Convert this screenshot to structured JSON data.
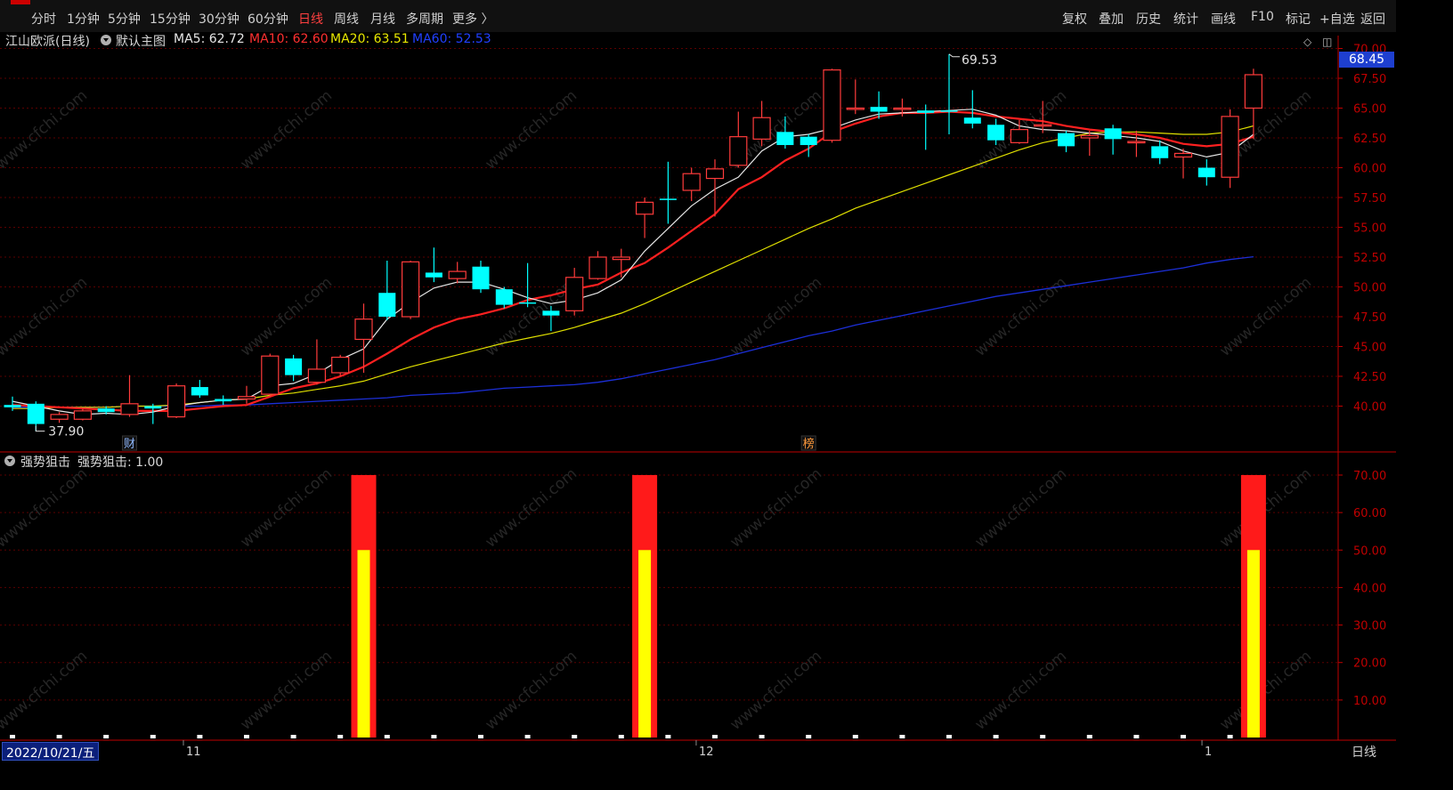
{
  "topbar": {
    "periods": [
      "分时",
      "1分钟",
      "5分钟",
      "15分钟",
      "30分钟",
      "60分钟",
      "日线",
      "周线",
      "月线",
      "多周期",
      "更多 〉"
    ],
    "active_period": "日线",
    "tools": [
      "复权",
      "叠加",
      "历史",
      "统计",
      "画线",
      "F10",
      "标记",
      "+自选",
      "返回"
    ]
  },
  "infobar": {
    "stock": "江山欧派(日线)",
    "template": "默认主图",
    "ma5": "MA5: 62.72",
    "ma10": "MA10: 62.60",
    "ma20": "MA20: 63.51",
    "ma60": "MA60: 52.53"
  },
  "subinfo": {
    "indicator": "强势狙击",
    "value_label": "强势狙击: 1.00"
  },
  "price_badge": "68.45",
  "date_label": "2022/10/21/五",
  "period_label": "日线",
  "watermark": "www.cfchi.com",
  "colors": {
    "up": "#ff3b3b",
    "down": "#00ffff",
    "ma5": "#e6e6e6",
    "ma10": "#ff2020",
    "ma20": "#e0e000",
    "ma60": "#1c2fd8",
    "bar_outer": "#ff1a1a",
    "bar_inner": "#ffff00",
    "axis_red": "#c00000"
  },
  "chart_data": [
    {
      "type": "candlestick",
      "title": "江山欧派(日线)",
      "ylim": [
        37.5,
        70.5
      ],
      "yticks": [
        "70.00",
        "67.50",
        "65.00",
        "62.50",
        "60.00",
        "57.50",
        "55.00",
        "52.50",
        "50.00",
        "47.50",
        "45.00",
        "42.50",
        "40.00"
      ],
      "xtick_labels": [
        "11",
        "12",
        "1"
      ],
      "candles": [
        {
          "o": 40.1,
          "c": 39.9,
          "h": 40.8,
          "l": 39.6
        },
        {
          "o": 40.2,
          "c": 38.5,
          "h": 40.4,
          "l": 37.9
        },
        {
          "o": 38.9,
          "c": 39.3,
          "h": 39.5,
          "l": 38.6
        },
        {
          "o": 38.9,
          "c": 39.6,
          "h": 39.8,
          "l": 38.8
        },
        {
          "o": 39.8,
          "c": 39.5,
          "h": 40.0,
          "l": 39.3
        },
        {
          "o": 39.3,
          "c": 40.2,
          "h": 42.6,
          "l": 39.1
        },
        {
          "o": 40.0,
          "c": 39.8,
          "h": 40.2,
          "l": 38.5
        },
        {
          "o": 39.1,
          "c": 41.7,
          "h": 41.9,
          "l": 39.0
        },
        {
          "o": 41.6,
          "c": 40.9,
          "h": 42.2,
          "l": 40.7
        },
        {
          "o": 40.6,
          "c": 40.4,
          "h": 40.9,
          "l": 40.1
        },
        {
          "o": 40.6,
          "c": 40.8,
          "h": 41.7,
          "l": 40.2
        },
        {
          "o": 41.0,
          "c": 44.2,
          "h": 44.4,
          "l": 40.8
        },
        {
          "o": 44.0,
          "c": 42.6,
          "h": 44.3,
          "l": 42.1
        },
        {
          "o": 42.0,
          "c": 43.1,
          "h": 45.6,
          "l": 41.8
        },
        {
          "o": 42.8,
          "c": 44.1,
          "h": 44.3,
          "l": 42.5
        },
        {
          "o": 45.6,
          "c": 47.3,
          "h": 48.6,
          "l": 42.8
        },
        {
          "o": 49.5,
          "c": 47.5,
          "h": 52.2,
          "l": 47.2
        },
        {
          "o": 47.5,
          "c": 52.1,
          "h": 52.2,
          "l": 47.3
        },
        {
          "o": 51.2,
          "c": 50.8,
          "h": 53.3,
          "l": 50.4
        },
        {
          "o": 50.7,
          "c": 51.3,
          "h": 52.1,
          "l": 50.3
        },
        {
          "o": 51.7,
          "c": 49.8,
          "h": 52.2,
          "l": 49.5
        },
        {
          "o": 49.8,
          "c": 48.5,
          "h": 50.0,
          "l": 48.2
        },
        {
          "o": 48.7,
          "c": 48.6,
          "h": 52.0,
          "l": 48.3
        },
        {
          "o": 48.0,
          "c": 47.6,
          "h": 48.4,
          "l": 46.3
        },
        {
          "o": 48.0,
          "c": 50.8,
          "h": 51.6,
          "l": 47.6
        },
        {
          "o": 50.7,
          "c": 52.5,
          "h": 53.0,
          "l": 50.6
        },
        {
          "o": 52.3,
          "c": 52.5,
          "h": 53.2,
          "l": 50.8
        },
        {
          "o": 56.1,
          "c": 57.1,
          "h": 57.5,
          "l": 54.1
        },
        {
          "o": 57.4,
          "c": 57.3,
          "h": 60.5,
          "l": 55.3
        },
        {
          "o": 58.1,
          "c": 59.5,
          "h": 60.0,
          "l": 57.2
        },
        {
          "o": 59.1,
          "c": 59.9,
          "h": 60.7,
          "l": 55.9
        },
        {
          "o": 60.2,
          "c": 62.6,
          "h": 64.7,
          "l": 60.0
        },
        {
          "o": 62.4,
          "c": 64.2,
          "h": 65.6,
          "l": 61.8
        },
        {
          "o": 63.0,
          "c": 61.9,
          "h": 64.3,
          "l": 61.6
        },
        {
          "o": 62.6,
          "c": 61.9,
          "h": 62.8,
          "l": 60.9
        },
        {
          "o": 62.3,
          "c": 68.2,
          "h": 68.3,
          "l": 62.1
        },
        {
          "o": 65.0,
          "c": 65.0,
          "h": 67.4,
          "l": 64.5
        },
        {
          "o": 65.1,
          "c": 64.7,
          "h": 66.4,
          "l": 64.1
        },
        {
          "o": 64.9,
          "c": 65.0,
          "h": 65.8,
          "l": 64.3
        },
        {
          "o": 64.8,
          "c": 64.6,
          "h": 65.3,
          "l": 61.5
        },
        {
          "o": 64.8,
          "c": 64.7,
          "h": 69.53,
          "l": 62.8
        },
        {
          "o": 64.2,
          "c": 63.7,
          "h": 66.5,
          "l": 63.3
        },
        {
          "o": 63.6,
          "c": 62.3,
          "h": 64.1,
          "l": 61.9
        },
        {
          "o": 62.1,
          "c": 63.2,
          "h": 64.0,
          "l": 62.0
        },
        {
          "o": 63.6,
          "c": 63.6,
          "h": 65.6,
          "l": 62.9
        },
        {
          "o": 62.9,
          "c": 61.8,
          "h": 63.1,
          "l": 61.3
        },
        {
          "o": 62.5,
          "c": 62.7,
          "h": 63.1,
          "l": 61.0
        },
        {
          "o": 63.3,
          "c": 62.4,
          "h": 63.6,
          "l": 61.1
        },
        {
          "o": 62.1,
          "c": 62.2,
          "h": 63.1,
          "l": 60.9
        },
        {
          "o": 61.8,
          "c": 60.8,
          "h": 62.3,
          "l": 60.3
        },
        {
          "o": 60.9,
          "c": 61.2,
          "h": 61.6,
          "l": 59.1
        },
        {
          "o": 60.0,
          "c": 59.2,
          "h": 60.7,
          "l": 58.5
        },
        {
          "o": 59.2,
          "c": 64.3,
          "h": 64.9,
          "l": 58.3
        },
        {
          "o": 65.0,
          "c": 67.8,
          "h": 68.3,
          "l": 62.4
        }
      ],
      "ma5": [
        40.4,
        40.0,
        39.6,
        39.3,
        39.4,
        39.3,
        39.5,
        40.0,
        40.3,
        40.5,
        40.6,
        41.7,
        41.9,
        42.7,
        43.9,
        44.8,
        47.3,
        48.7,
        49.9,
        50.4,
        50.4,
        49.8,
        49.1,
        48.6,
        48.9,
        49.5,
        50.6,
        53.0,
        54.9,
        56.8,
        58.2,
        59.2,
        61.4,
        62.6,
        62.8,
        63.3,
        64.0,
        64.5,
        64.6,
        64.7,
        64.8,
        64.9,
        64.4,
        63.5,
        63.2,
        63.1,
        62.9,
        62.7,
        62.5,
        62.2,
        61.4,
        60.9,
        61.3,
        62.8
      ],
      "ma10": [
        40.1,
        40.0,
        39.9,
        39.8,
        39.7,
        39.6,
        39.6,
        39.6,
        39.8,
        40.0,
        40.1,
        40.8,
        41.5,
        41.9,
        42.5,
        43.3,
        44.4,
        45.6,
        46.6,
        47.3,
        47.7,
        48.2,
        48.9,
        49.3,
        49.8,
        50.2,
        51.2,
        52.0,
        53.3,
        54.7,
        56.1,
        58.2,
        59.2,
        60.6,
        61.6,
        63.0,
        63.7,
        64.3,
        64.6,
        64.6,
        64.7,
        64.6,
        64.3,
        64.1,
        63.9,
        63.5,
        63.2,
        63.0,
        62.8,
        62.5,
        62.0,
        61.8,
        62.0,
        62.6
      ],
      "ma20": [
        39.8,
        39.8,
        39.9,
        39.9,
        39.9,
        40.0,
        40.0,
        40.1,
        40.3,
        40.5,
        40.6,
        40.9,
        41.1,
        41.4,
        41.7,
        42.1,
        42.7,
        43.3,
        43.8,
        44.3,
        44.8,
        45.3,
        45.7,
        46.1,
        46.6,
        47.2,
        47.8,
        48.6,
        49.5,
        50.4,
        51.3,
        52.2,
        53.1,
        54.0,
        54.9,
        55.7,
        56.6,
        57.3,
        58.0,
        58.7,
        59.4,
        60.1,
        60.8,
        61.5,
        62.1,
        62.5,
        62.9,
        63.0,
        63.0,
        62.9,
        62.8,
        62.8,
        63.0,
        63.51
      ],
      "ma60": [
        39.9,
        39.9,
        39.9,
        39.9,
        39.9,
        40.0,
        40.0,
        40.0,
        40.0,
        40.1,
        40.1,
        40.2,
        40.3,
        40.4,
        40.5,
        40.6,
        40.7,
        40.9,
        41.0,
        41.1,
        41.3,
        41.5,
        41.6,
        41.7,
        41.8,
        42.0,
        42.3,
        42.7,
        43.1,
        43.5,
        43.9,
        44.4,
        44.9,
        45.4,
        45.9,
        46.3,
        46.8,
        47.2,
        47.6,
        48.0,
        48.4,
        48.8,
        49.2,
        49.5,
        49.8,
        50.1,
        50.4,
        50.7,
        51.0,
        51.3,
        51.6,
        52.0,
        52.3,
        52.53
      ],
      "annotations": {
        "high_label": "69.53",
        "low_label": "37.90",
        "event_labels": [
          "财",
          "榜"
        ],
        "event_indices": [
          5,
          34
        ]
      }
    },
    {
      "type": "bar",
      "title": "强势狙击",
      "ylim": [
        0,
        75
      ],
      "yticks": [
        "70.00",
        "60.00",
        "50.00",
        "40.00",
        "30.00",
        "20.00",
        "10.00"
      ],
      "signal_indices": [
        15,
        27,
        53
      ],
      "outer_value": 70,
      "inner_value": 50,
      "marker_value": 0
    }
  ]
}
